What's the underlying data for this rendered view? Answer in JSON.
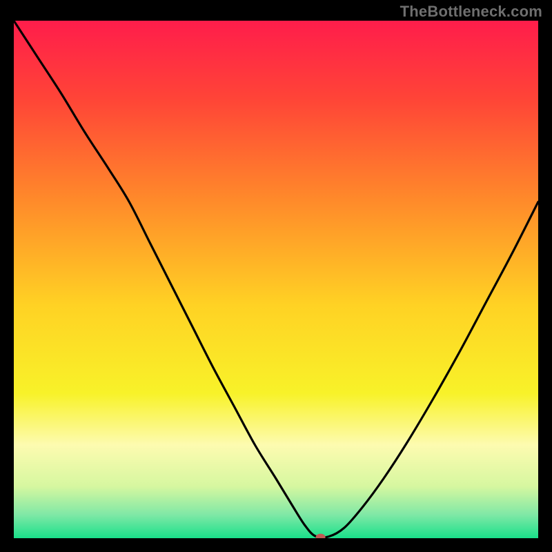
{
  "watermark": "TheBottleneck.com",
  "chart_data": {
    "type": "line",
    "title": "",
    "xlabel": "",
    "ylabel": "",
    "xlim": [
      0,
      100
    ],
    "ylim": [
      0,
      100
    ],
    "grid": false,
    "legend": false,
    "background_gradient": {
      "stops": [
        {
          "offset": 0.0,
          "color": "#ff1d4b"
        },
        {
          "offset": 0.15,
          "color": "#ff4437"
        },
        {
          "offset": 0.35,
          "color": "#ff8b2a"
        },
        {
          "offset": 0.55,
          "color": "#ffd224"
        },
        {
          "offset": 0.72,
          "color": "#f8f229"
        },
        {
          "offset": 0.82,
          "color": "#fdfbb0"
        },
        {
          "offset": 0.9,
          "color": "#d6f7a0"
        },
        {
          "offset": 0.955,
          "color": "#7fe8a6"
        },
        {
          "offset": 1.0,
          "color": "#19e08a"
        }
      ]
    },
    "series": [
      {
        "name": "bottleneck-curve",
        "x": [
          0.0,
          4.5,
          9.0,
          13.5,
          18.0,
          22.0,
          26.0,
          30.0,
          34.0,
          38.0,
          42.0,
          46.0,
          50.0,
          53.0,
          55.5,
          57.5,
          60.0,
          63.0,
          66.5,
          70.5,
          75.0,
          80.0,
          85.0,
          90.0,
          95.0,
          100.0
        ],
        "y": [
          100.0,
          93.0,
          86.0,
          78.5,
          71.5,
          65.0,
          57.0,
          49.0,
          41.0,
          33.0,
          25.5,
          18.0,
          11.5,
          6.5,
          2.5,
          0.4,
          0.3,
          2.0,
          6.0,
          11.5,
          18.5,
          27.0,
          36.0,
          45.5,
          55.0,
          65.0
        ]
      }
    ],
    "marker": {
      "name": "optimal-point",
      "x": 58.5,
      "y": 0.2,
      "color": "#c15a55",
      "rx": 7,
      "ry": 5
    }
  }
}
